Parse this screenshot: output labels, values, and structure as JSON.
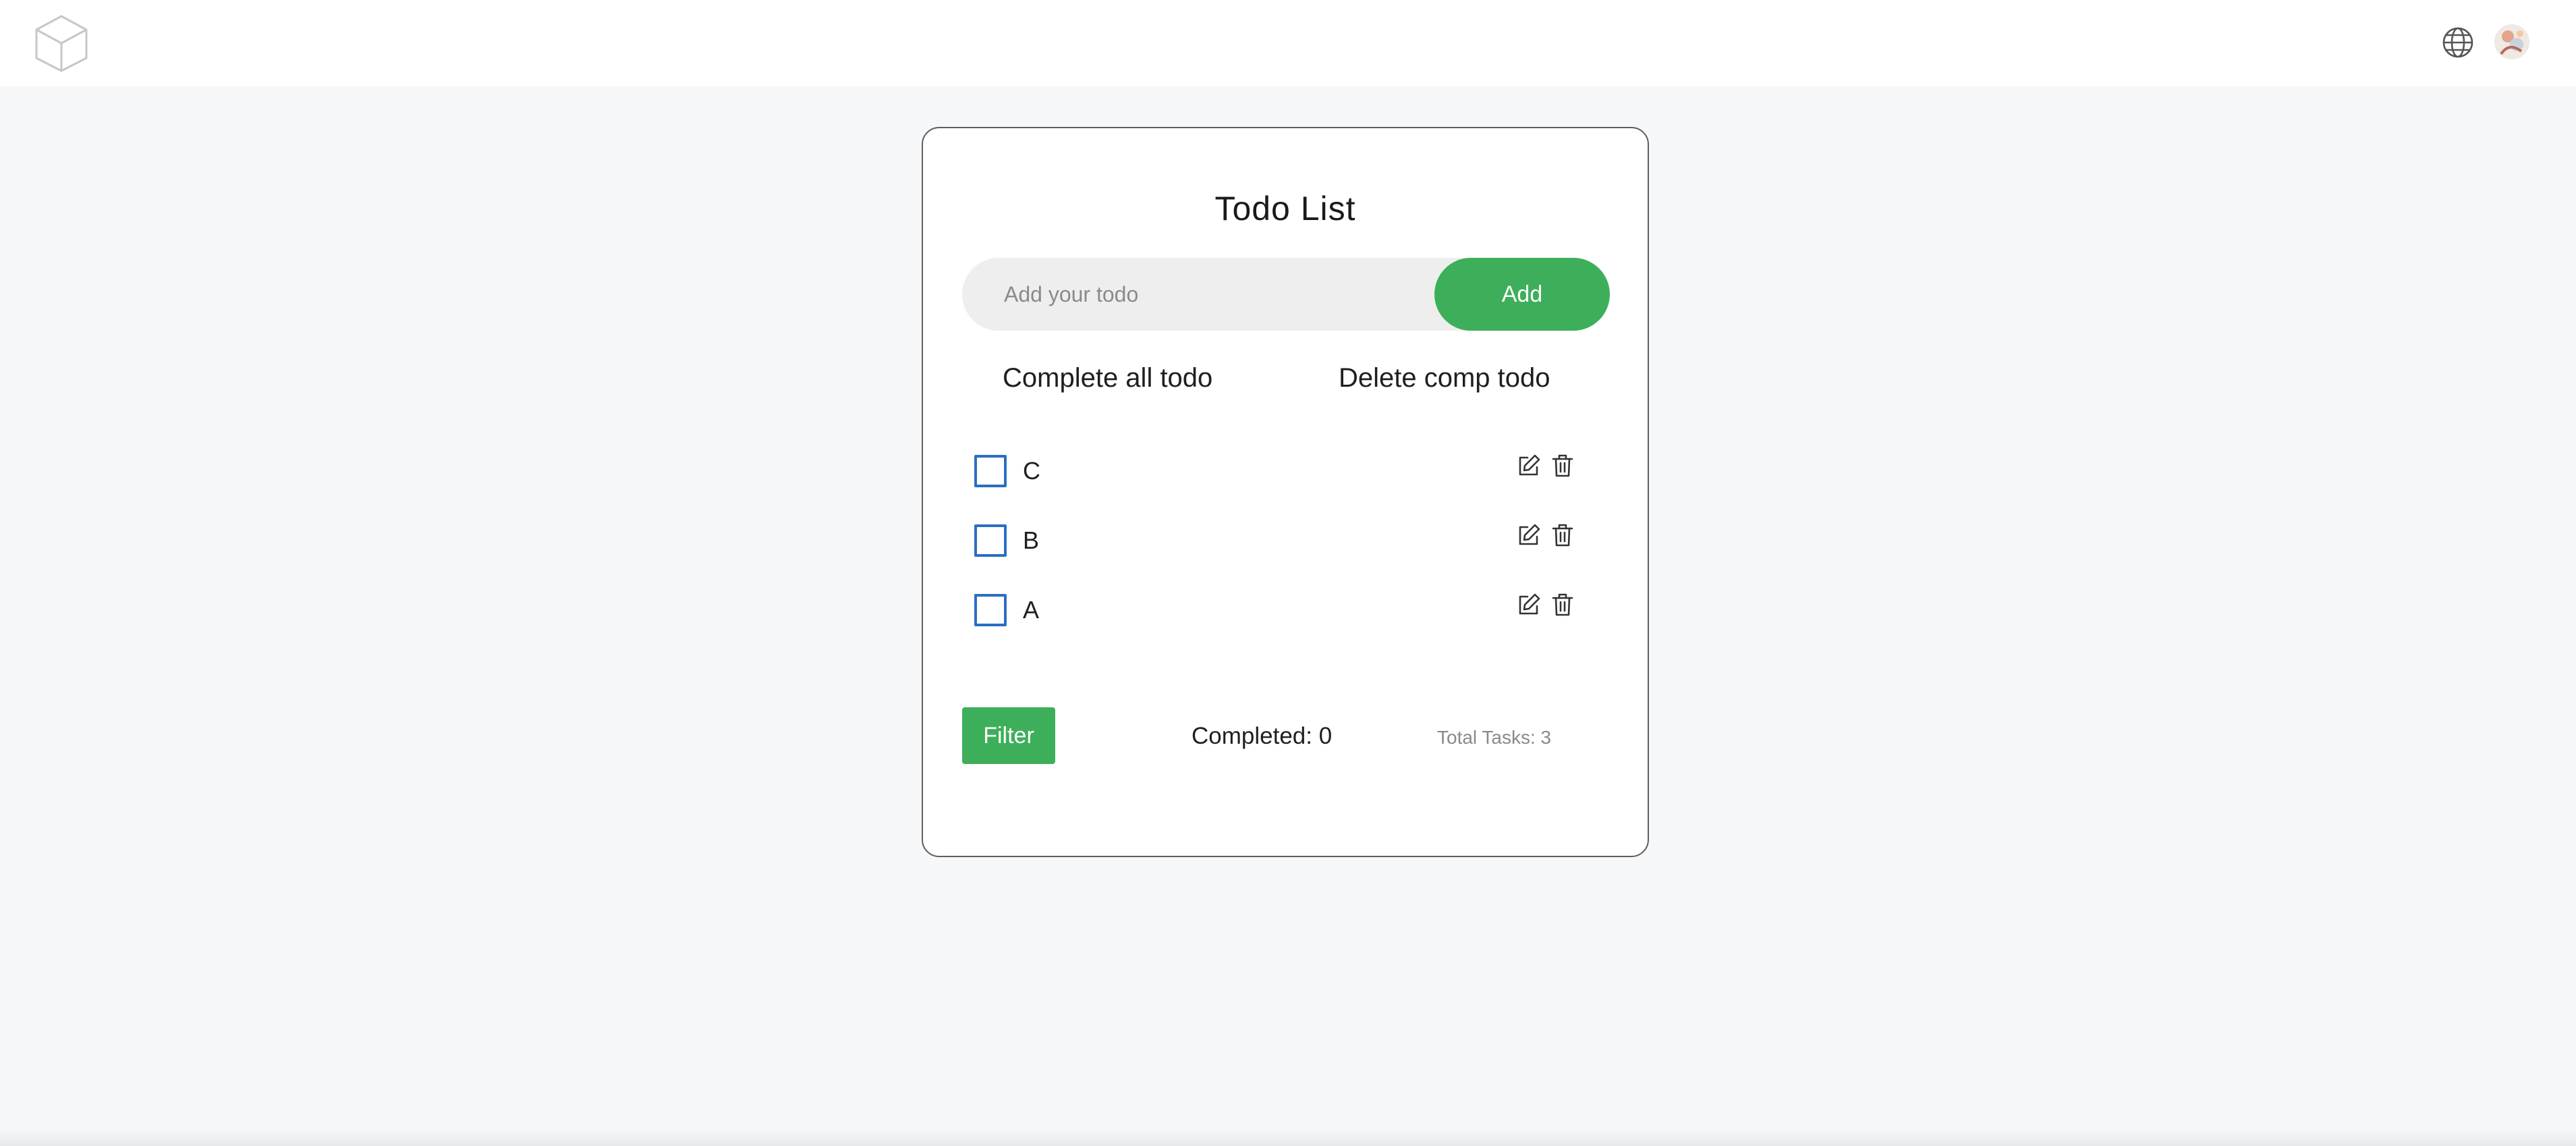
{
  "header": {
    "logo_icon": "cube-icon",
    "language_icon": "globe-icon",
    "avatar_icon": "user-avatar"
  },
  "todo": {
    "title": "Todo List",
    "input_placeholder": "Add your todo",
    "input_value": "",
    "add_label": "Add",
    "complete_all_label": "Complete all todo",
    "delete_completed_label": "Delete comp todo",
    "items": [
      {
        "text": "C",
        "completed": false
      },
      {
        "text": "B",
        "completed": false
      },
      {
        "text": "A",
        "completed": false
      }
    ],
    "filter_label": "Filter",
    "completed_text": "Completed: 0",
    "total_text": "Total Tasks: 3"
  },
  "colors": {
    "accent_green": "#3daf5a",
    "checkbox_blue": "#2a6fc2",
    "page_background": "#f6f7f9"
  }
}
